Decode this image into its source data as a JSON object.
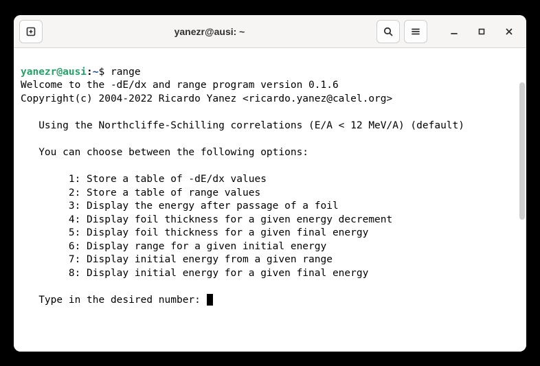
{
  "window": {
    "title": "yanezr@ausi: ~"
  },
  "prompt": {
    "user_host": "yanezr@ausi",
    "sep": ":",
    "path": "~",
    "symbol": "$ ",
    "command": "range"
  },
  "output": {
    "welcome": "Welcome to the -dE/dx and range program version 0.1.6",
    "copyright": "Copyright(c) 2004-2022 Ricardo Yanez <ricardo.yanez@calel.org>",
    "using": "   Using the Northcliffe-Schilling correlations (E/A < 12 MeV/A) (default)",
    "choose": "   You can choose between the following options:",
    "options": {
      "o1": "        1: Store a table of -dE/dx values",
      "o2": "        2: Store a table of range values",
      "o3": "        3: Display the energy after passage of a foil",
      "o4": "        4: Display foil thickness for a given energy decrement",
      "o5": "        5: Display foil thickness for a given final energy",
      "o6": "        6: Display range for a given initial energy",
      "o7": "        7: Display initial energy from a given range",
      "o8": "        8: Display initial energy for a given final energy"
    },
    "typein": "   Type in the desired number: "
  }
}
